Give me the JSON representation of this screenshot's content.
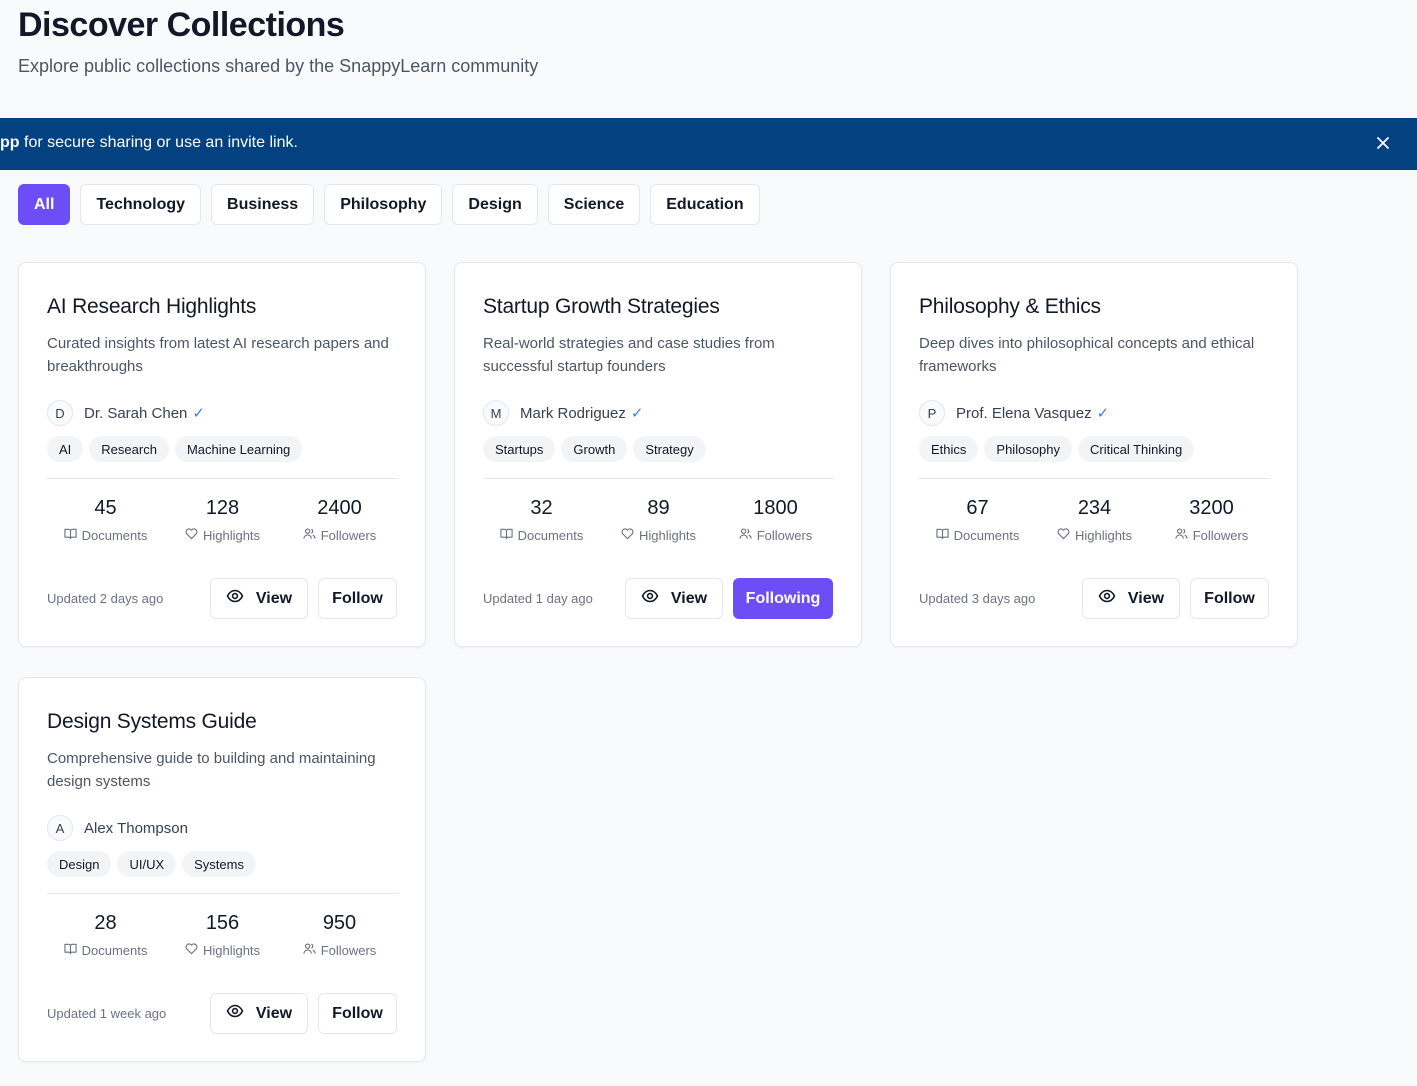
{
  "header": {
    "title": "Discover Collections",
    "subtitle": "Explore public collections shared by the SnappyLearn community"
  },
  "banner": {
    "bold_fragment": "pp",
    "text": " for secure sharing or use an invite link.",
    "background": "#034181"
  },
  "filters": [
    "All",
    "Technology",
    "Business",
    "Philosophy",
    "Design",
    "Science",
    "Education"
  ],
  "active_filter": "All",
  "accent_color": "#6d4ef6",
  "stat_labels": {
    "documents": "Documents",
    "highlights": "Highlights",
    "followers": "Followers"
  },
  "buttons": {
    "view": "View"
  },
  "cards": [
    {
      "title": "AI Research Highlights",
      "description": "Curated insights from latest AI research papers and breakthroughs",
      "avatar_initial": "D",
      "author": "Dr. Sarah Chen",
      "verified_mark": "✓",
      "tags": [
        "AI",
        "Research",
        "Machine Learning"
      ],
      "documents": "45",
      "highlights": "128",
      "followers": "2400",
      "updated": "Updated 2 days ago",
      "follow_label": "Follow"
    },
    {
      "title": "Startup Growth Strategies",
      "description": "Real-world strategies and case studies from successful startup founders",
      "avatar_initial": "M",
      "author": "Mark Rodriguez",
      "verified_mark": "✓",
      "tags": [
        "Startups",
        "Growth",
        "Strategy"
      ],
      "documents": "32",
      "highlights": "89",
      "followers": "1800",
      "updated": "Updated 1 day ago",
      "follow_label": "Following"
    },
    {
      "title": "Philosophy & Ethics",
      "description": "Deep dives into philosophical concepts and ethical frameworks",
      "avatar_initial": "P",
      "author": "Prof. Elena Vasquez",
      "verified_mark": "✓",
      "tags": [
        "Ethics",
        "Philosophy",
        "Critical Thinking"
      ],
      "documents": "67",
      "highlights": "234",
      "followers": "3200",
      "updated": "Updated 3 days ago",
      "follow_label": "Follow"
    },
    {
      "title": "Design Systems Guide",
      "description": "Comprehensive guide to building and maintaining design systems",
      "avatar_initial": "A",
      "author": "Alex Thompson",
      "verified_mark": "",
      "tags": [
        "Design",
        "UI/UX",
        "Systems"
      ],
      "documents": "28",
      "highlights": "156",
      "followers": "950",
      "updated": "Updated 1 week ago",
      "follow_label": "Follow"
    }
  ]
}
